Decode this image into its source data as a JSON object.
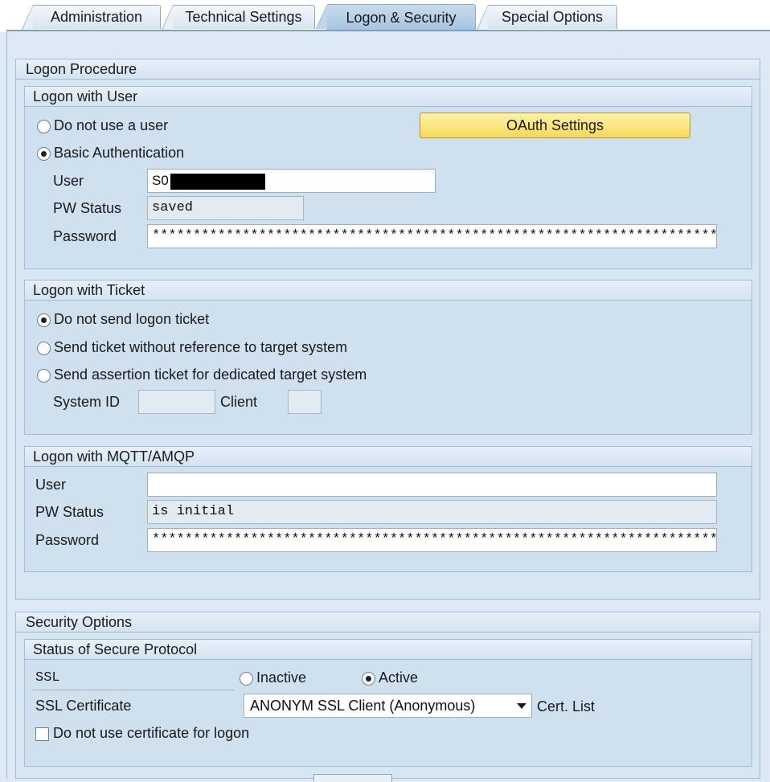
{
  "tabs": [
    {
      "label": "Administration",
      "active": false
    },
    {
      "label": "Technical Settings",
      "active": false
    },
    {
      "label": "Logon & Security",
      "active": true
    },
    {
      "label": "Special Options",
      "active": false
    }
  ],
  "logon_procedure": {
    "title": "Logon Procedure",
    "logon_with_user": {
      "title": "Logon with User",
      "radio_no_user": "Do not use a user",
      "radio_basic_auth": "Basic Authentication",
      "selected": "basic_auth",
      "oauth_button": "OAuth Settings",
      "user_label": "User",
      "user_value": "S0",
      "pw_status_label": "PW Status",
      "pw_status_value": "saved",
      "password_label": "Password",
      "password_value": "**********************************************************************"
    },
    "logon_with_ticket": {
      "title": "Logon with Ticket",
      "radio_no_ticket": "Do not send logon ticket",
      "radio_send_ticket": "Send ticket without reference to target system",
      "radio_assertion": "Send assertion ticket for dedicated target system",
      "selected": "no_ticket",
      "system_id_label": "System ID",
      "system_id_value": "",
      "client_label": "Client",
      "client_value": ""
    },
    "logon_with_mqtt": {
      "title": "Logon with MQTT/AMQP",
      "user_label": "User",
      "user_value": "",
      "pw_status_label": "PW Status",
      "pw_status_value": "is initial",
      "password_label": "Password",
      "password_value": "**********************************************************************"
    }
  },
  "security_options": {
    "title": "Security Options",
    "secure_protocol": {
      "title": "Status of Secure Protocol",
      "ssl_label": "SSL",
      "radio_inactive": "Inactive",
      "radio_active": "Active",
      "selected": "active",
      "ssl_cert_label": "SSL Certificate",
      "ssl_cert_value": "ANONYM SSL Client (Anonymous)",
      "cert_list_label": "Cert. List",
      "no_cert_logon_label": "Do not use certificate for logon",
      "no_cert_logon_checked": false
    }
  },
  "colors": {
    "accent_button": "#f7d85a",
    "panel_background": "#dde9f4",
    "active_tab": "#a6c3e0"
  }
}
